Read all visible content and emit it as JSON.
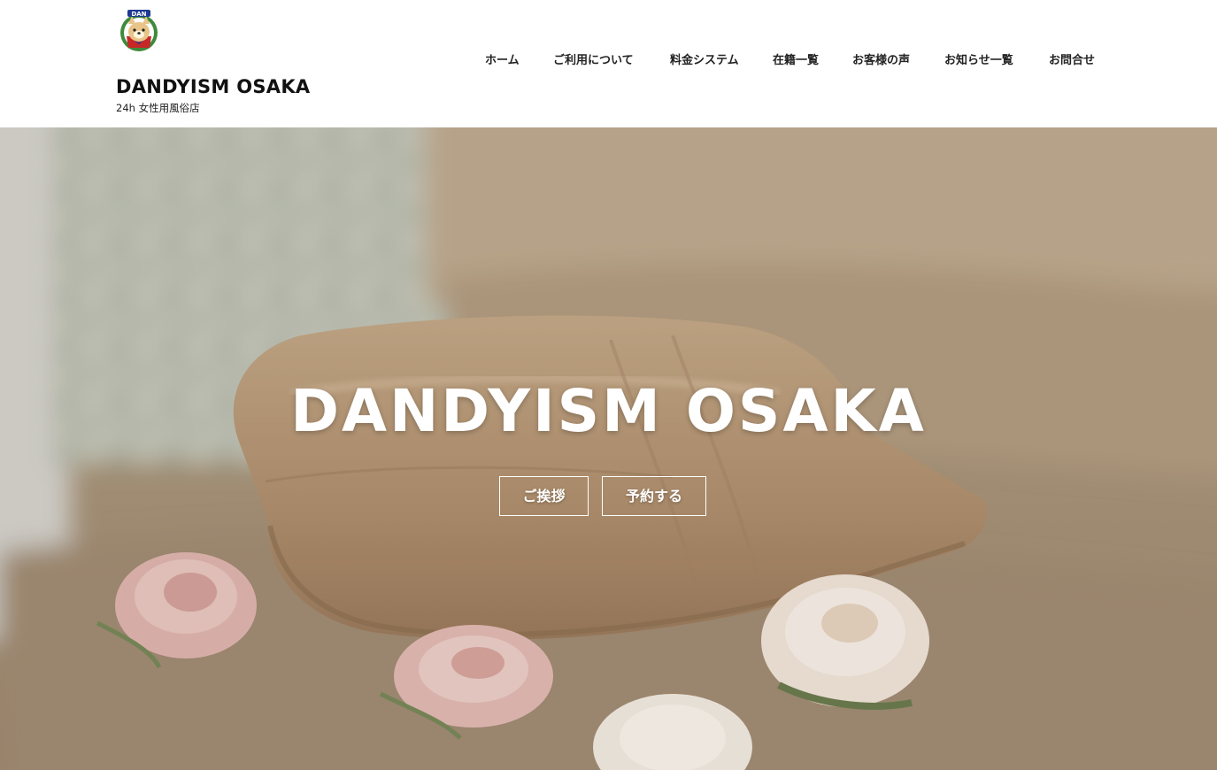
{
  "header": {
    "site_title": "DANDYISM OSAKA",
    "tagline": "24h 女性用風俗店",
    "logo_icon": "dog-mascot-logo-icon",
    "logo_text": "DAN"
  },
  "nav": {
    "items": [
      {
        "label": "ホーム"
      },
      {
        "label": "ご利用について"
      },
      {
        "label": "料金システム"
      },
      {
        "label": "在籍一覧"
      },
      {
        "label": "お客様の声"
      },
      {
        "label": "お知らせ一覧"
      },
      {
        "label": "お問合せ"
      }
    ]
  },
  "hero": {
    "title": "DANDYISM OSAKA",
    "buttons": {
      "greeting": "ご挨拶",
      "reserve": "予約する"
    },
    "background": "folded-towel-and-roses-photo"
  },
  "colors": {
    "header_bg": "#ffffff",
    "text": "#111111",
    "hero_overlay_text": "#ffffff",
    "towel": "#b39574",
    "bed": "#a8947c"
  }
}
